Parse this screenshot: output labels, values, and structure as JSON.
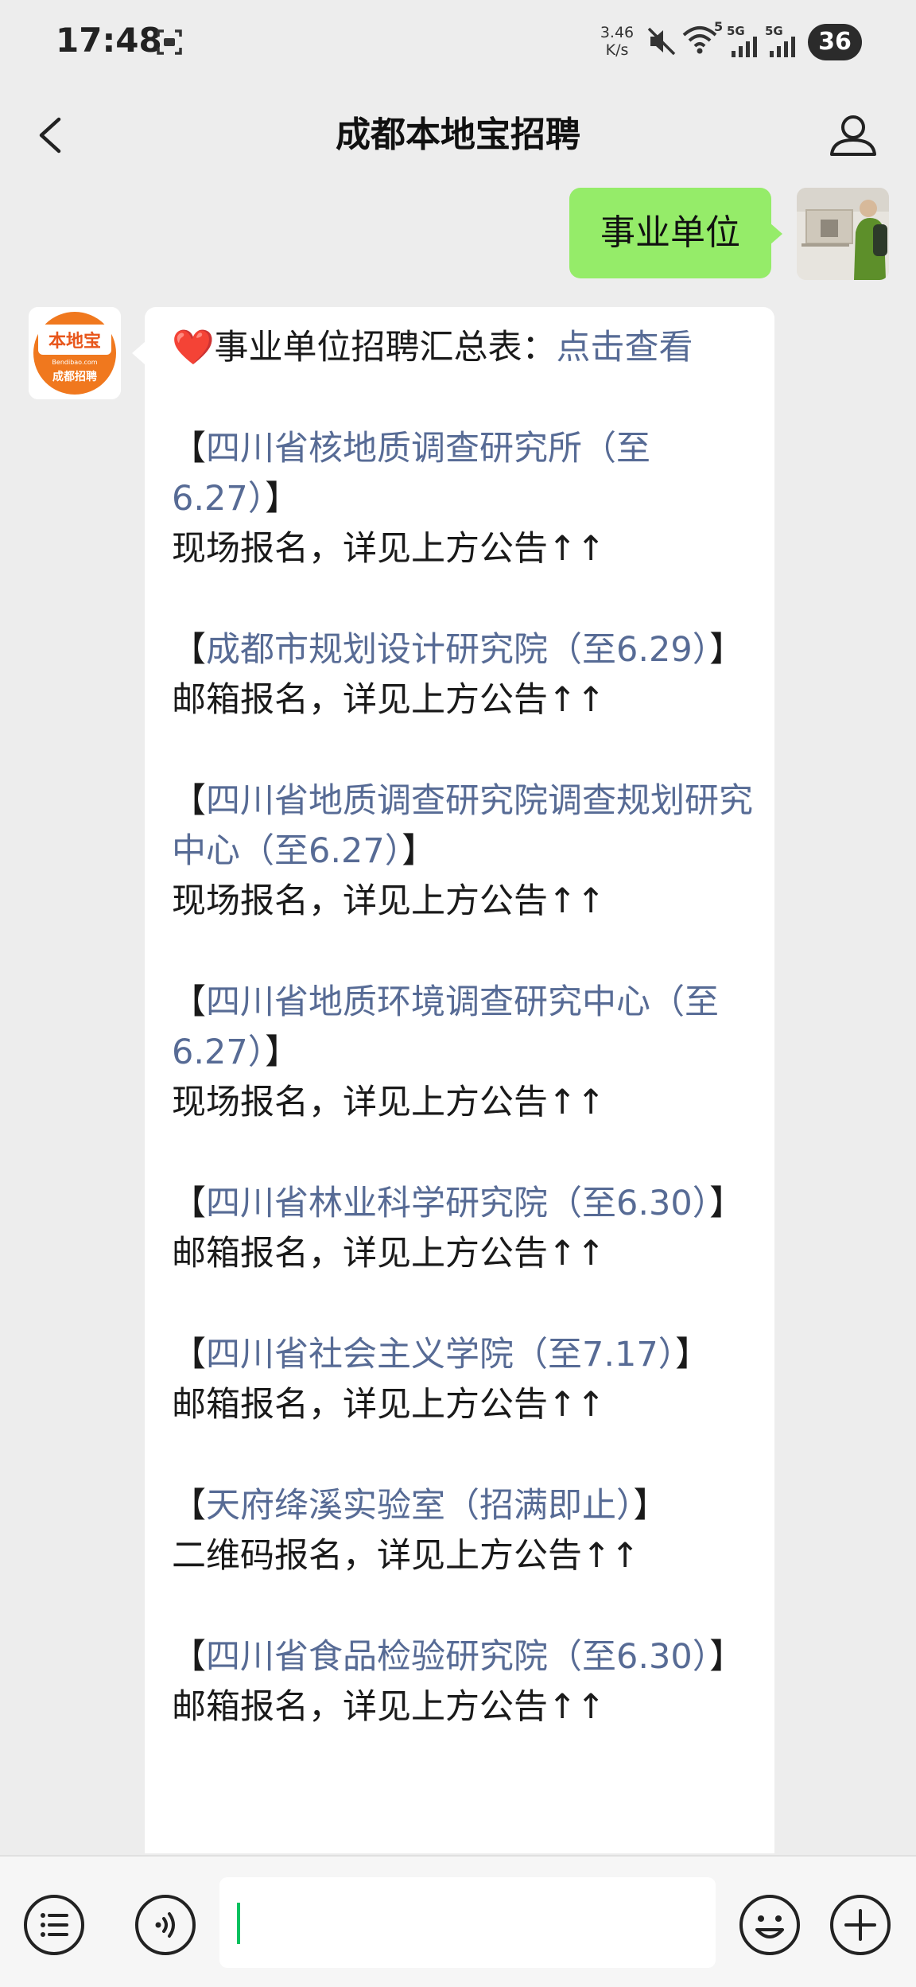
{
  "status_bar": {
    "time": "17:48",
    "net_speed_value": "3.46",
    "net_speed_unit": "K/s",
    "wifi_badge": "5",
    "signal_1_label": "5G",
    "signal_2_label": "5G",
    "battery_level": "36",
    "icons": [
      "screen-record-icon",
      "mute-icon",
      "wifi-icon",
      "signal-icon",
      "signal-icon",
      "battery-icon"
    ]
  },
  "nav": {
    "title": "成都本地宝招聘"
  },
  "chat": {
    "sent_message": "事业单位",
    "bot_avatar": {
      "brand": "本地宝",
      "domain": "Bendibao.com",
      "label": "成都招聘",
      "color": "#f0781e"
    },
    "reply": {
      "header_emoji": "❤️",
      "header_text": "事业单位招聘汇总表：",
      "header_link": "点击查看",
      "entries": [
        {
          "name": "四川省核地质调查研究所（至6.27）",
          "method": "现场报名，详见上方公告↑↑"
        },
        {
          "name": "成都市规划设计研究院（至6.29）",
          "method": "邮箱报名，详见上方公告↑↑"
        },
        {
          "name": "四川省地质调查研究院调查规划研究中心（至6.27）",
          "method": "现场报名，详见上方公告↑↑"
        },
        {
          "name": "四川省地质环境调查研究中心（至6.27）",
          "method": "现场报名，详见上方公告↑↑"
        },
        {
          "name": "四川省林业科学研究院（至6.30）",
          "method": "邮箱报名，详见上方公告↑↑"
        },
        {
          "name": "四川省社会主义学院（至7.17）",
          "method": "邮箱报名，详见上方公告↑↑"
        },
        {
          "name": "天府绛溪实验室（招满即止）",
          "method": "二维码报名，详见上方公告↑↑"
        },
        {
          "name": "四川省食品检验研究院（至6.30）",
          "method": "邮箱报名，详见上方公告↑↑"
        }
      ]
    }
  },
  "input_bar": {
    "input_value": "",
    "icons": [
      "menu-icon",
      "voice-icon",
      "emoji-icon",
      "plus-icon"
    ]
  },
  "colors": {
    "background": "#ededed",
    "sent_bubble": "#95ec69",
    "link": "#576b95",
    "caret": "#07c160",
    "brand_orange": "#f0781e"
  }
}
